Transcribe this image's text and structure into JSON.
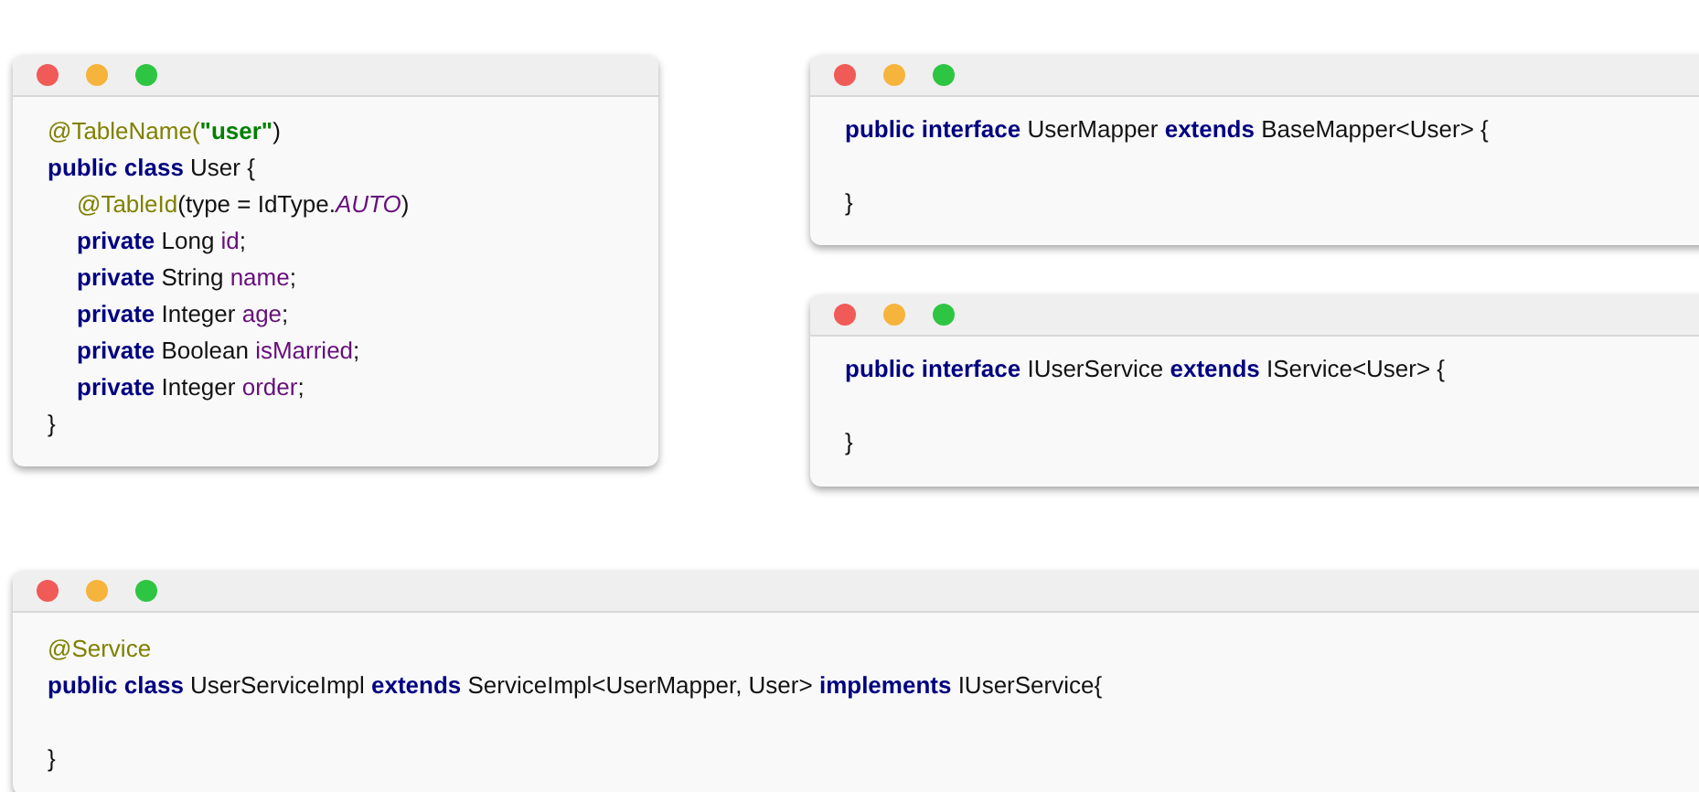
{
  "windows": [
    {
      "lines": [
        {
          "kind": "code",
          "tokens": [
            {
              "text": "@TableName(",
              "kind": "annotation"
            },
            {
              "text": "\"user\"",
              "kind": "string"
            },
            {
              "text": ")",
              "kind": "plain"
            }
          ]
        },
        {
          "kind": "code",
          "tokens": [
            {
              "text": "public class ",
              "kind": "keyword"
            },
            {
              "text": "User {",
              "kind": "plain"
            }
          ],
          "children": [
            {
              "kind": "code",
              "tokens": [
                {
                  "text": "@TableId",
                  "kind": "annotation"
                },
                {
                  "text": "(type = IdType.",
                  "kind": "plain"
                },
                {
                  "text": "AUTO",
                  "kind": "constant"
                },
                {
                  "text": ")",
                  "kind": "plain"
                }
              ]
            },
            {
              "kind": "code",
              "tokens": [
                {
                  "text": "private ",
                  "kind": "keyword"
                },
                {
                  "text": "Long ",
                  "kind": "plain"
                },
                {
                  "text": "id",
                  "kind": "field"
                },
                {
                  "text": ";",
                  "kind": "plain"
                }
              ]
            },
            {
              "kind": "code",
              "tokens": [
                {
                  "text": "private ",
                  "kind": "keyword"
                },
                {
                  "text": "String ",
                  "kind": "plain"
                },
                {
                  "text": "name",
                  "kind": "field"
                },
                {
                  "text": ";",
                  "kind": "plain"
                }
              ]
            },
            {
              "kind": "code",
              "tokens": [
                {
                  "text": "private ",
                  "kind": "keyword"
                },
                {
                  "text": "Integer ",
                  "kind": "plain"
                },
                {
                  "text": "age",
                  "kind": "field"
                },
                {
                  "text": ";",
                  "kind": "plain"
                }
              ]
            },
            {
              "kind": "code",
              "tokens": [
                {
                  "text": "private ",
                  "kind": "keyword"
                },
                {
                  "text": "Boolean ",
                  "kind": "plain"
                },
                {
                  "text": "isMarried",
                  "kind": "field"
                },
                {
                  "text": ";",
                  "kind": "plain"
                }
              ]
            },
            {
              "kind": "code",
              "tokens": [
                {
                  "text": "private ",
                  "kind": "keyword"
                },
                {
                  "text": "Integer ",
                  "kind": "plain"
                },
                {
                  "text": "order",
                  "kind": "field"
                },
                {
                  "text": ";",
                  "kind": "plain"
                }
              ]
            }
          ]
        },
        {
          "kind": "code",
          "tokens": [
            {
              "text": "}",
              "kind": "plain"
            }
          ]
        }
      ]
    },
    {
      "lines": [
        {
          "kind": "code",
          "tokens": [
            {
              "text": "public interface ",
              "kind": "keyword"
            },
            {
              "text": "UserMapper ",
              "kind": "plain"
            },
            {
              "text": "extends ",
              "kind": "keyword"
            },
            {
              "text": "BaseMapper<User> {",
              "kind": "plain"
            }
          ]
        },
        {
          "kind": "blank"
        },
        {
          "kind": "code",
          "tokens": [
            {
              "text": "}",
              "kind": "plain"
            }
          ]
        }
      ]
    },
    {
      "lines": [
        {
          "kind": "code",
          "tokens": [
            {
              "text": "public interface ",
              "kind": "keyword"
            },
            {
              "text": "IUserService ",
              "kind": "plain"
            },
            {
              "text": "extends ",
              "kind": "keyword"
            },
            {
              "text": "IService<User> {",
              "kind": "plain"
            }
          ]
        },
        {
          "kind": "blank"
        },
        {
          "kind": "code",
          "tokens": [
            {
              "text": "}",
              "kind": "plain"
            }
          ]
        }
      ]
    },
    {
      "lines": [
        {
          "kind": "code",
          "tokens": [
            {
              "text": "@Service",
              "kind": "annotation"
            }
          ]
        },
        {
          "kind": "code",
          "tokens": [
            {
              "text": "public class ",
              "kind": "keyword"
            },
            {
              "text": "UserServiceImpl ",
              "kind": "plain"
            },
            {
              "text": "extends ",
              "kind": "keyword"
            },
            {
              "text": "ServiceImpl<UserMapper, User> ",
              "kind": "plain"
            },
            {
              "text": "implements ",
              "kind": "keyword"
            },
            {
              "text": "IUserService{",
              "kind": "plain"
            }
          ]
        },
        {
          "kind": "blank"
        },
        {
          "kind": "code",
          "tokens": [
            {
              "text": "}",
              "kind": "plain"
            }
          ]
        }
      ]
    }
  ]
}
